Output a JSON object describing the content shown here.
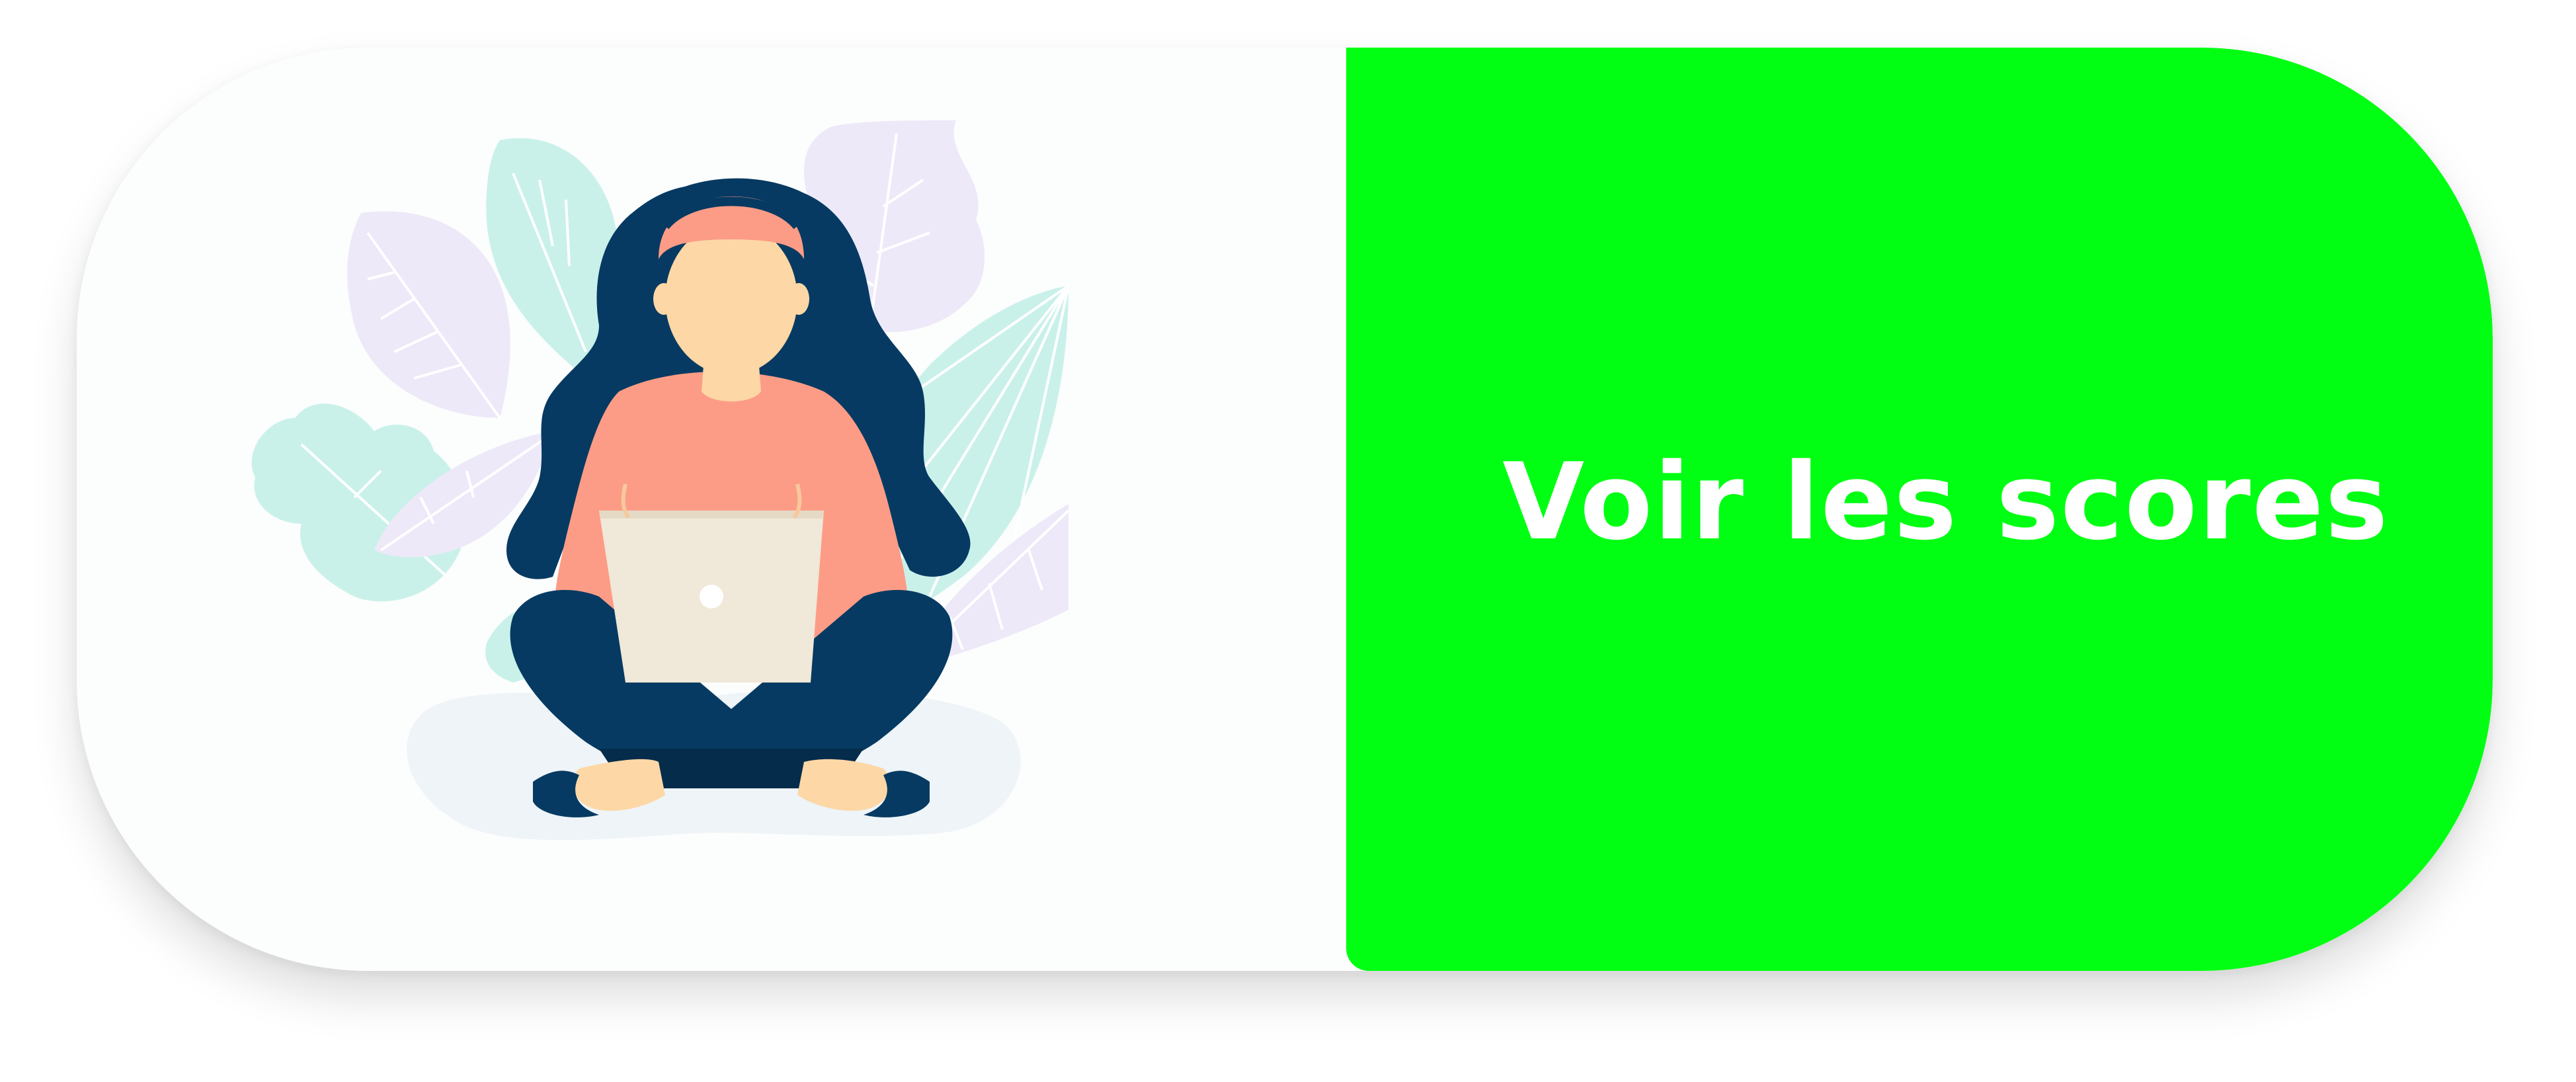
{
  "card": {
    "illustration": {
      "icon": "woman-with-laptop-illustration"
    },
    "cta": {
      "label": "Voir les scores"
    }
  },
  "colors": {
    "cta_background": "#00ff12",
    "cta_text": "#ffffff",
    "card_background": "#ffffff",
    "hair": "#063a62",
    "skin": "#fdd7a6",
    "sweater": "#fd9c86",
    "laptop": "#f0e8d8",
    "leaf_mint": "#c9f1ea",
    "leaf_lavender": "#ede9f8"
  }
}
